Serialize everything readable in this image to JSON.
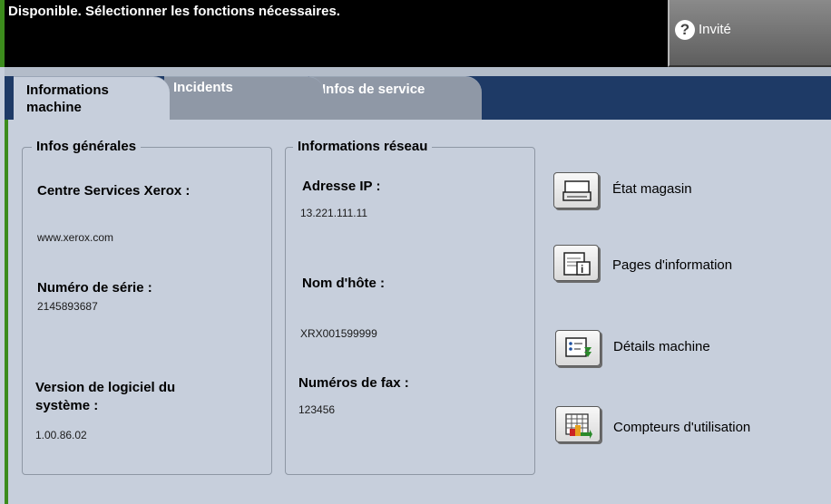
{
  "header": {
    "status_text": "Disponible.  Sélectionner les fonctions nécessaires.",
    "guest_label": "Invité",
    "guest_icon": "help-icon"
  },
  "tabs": [
    {
      "label": "Informations machine",
      "active": true
    },
    {
      "label": "Incidents",
      "active": false
    },
    {
      "label": "Infos de service",
      "active": false
    }
  ],
  "general": {
    "title": "Infos générales",
    "service_center_label": "Centre Services Xerox :",
    "service_center_value": "www.xerox.com",
    "serial_label": "Numéro de série :",
    "serial_value": "2145893687",
    "software_label": "Version de logiciel du système :",
    "software_value": "1.00.86.02"
  },
  "network": {
    "title": "Informations réseau",
    "ip_label": "Adresse IP :",
    "ip_value": "13.221.111.11",
    "host_label": "Nom d'hôte :",
    "host_value": "XRX001599999",
    "fax_label": "Numéros de fax :",
    "fax_value": "123456"
  },
  "actions": [
    {
      "label": "État magasin",
      "icon": "tray-icon"
    },
    {
      "label": "Pages d'information",
      "icon": "info-pages-icon"
    },
    {
      "label": "Détails machine",
      "icon": "machine-details-icon"
    },
    {
      "label": "Compteurs d'utilisation",
      "icon": "usage-counters-icon"
    }
  ],
  "colors": {
    "accent": "#3c8c1c",
    "tab_strip": "#1e3a66",
    "background": "#c7cfdc"
  }
}
